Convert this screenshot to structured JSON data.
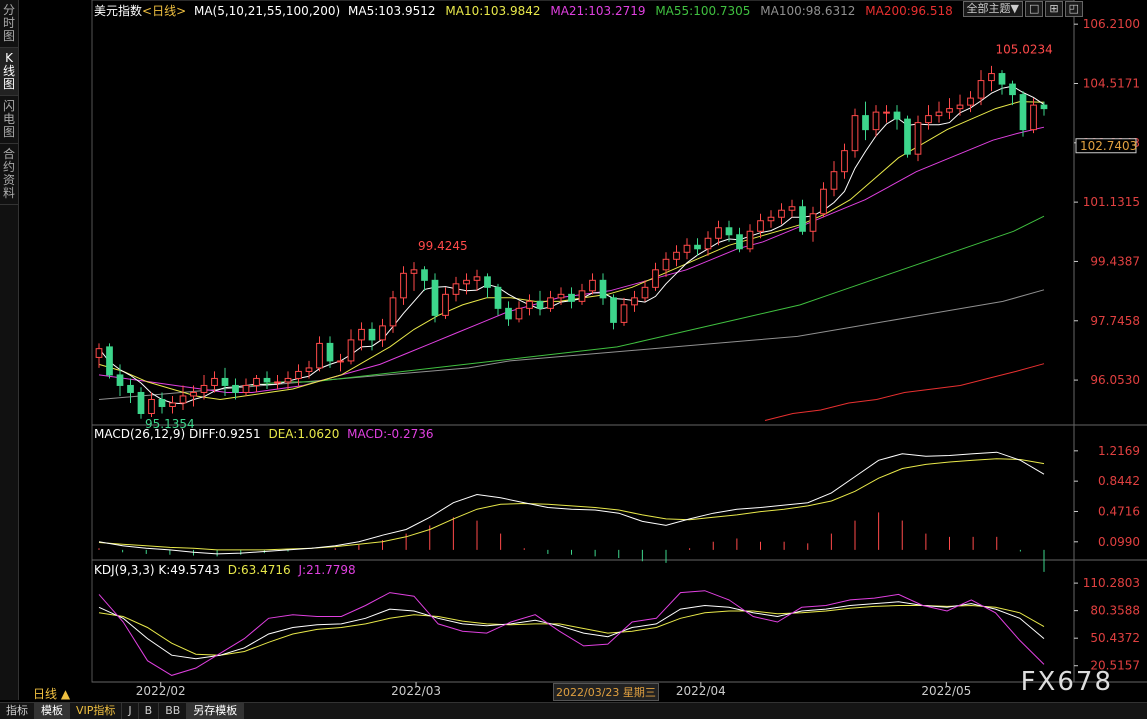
{
  "side_tabs": [
    {
      "label": "分时图"
    },
    {
      "label": "K线图"
    },
    {
      "label": "闪电图"
    },
    {
      "label": "合约资料"
    }
  ],
  "header": {
    "name": "美元指数",
    "period_tag": "<日线>",
    "ma_params": "MA(5,10,21,55,100,200)",
    "ma5": "MA5:103.9512",
    "ma10": "MA10:103.9842",
    "ma21": "MA21:103.2719",
    "ma55": "MA55:100.7305",
    "ma100": "MA100:98.6312",
    "ma200": "MA200:96.518",
    "theme_btn": "全部主题▼"
  },
  "macd_header": {
    "name": "MACD(26,12,9)",
    "diff": "DIFF:0.9251",
    "dea": "DEA:1.0620",
    "macd": "MACD:-0.2736"
  },
  "kdj_header": {
    "name": "KDJ(9,3,3)",
    "k": "K:49.5743",
    "d": "D:63.4716",
    "j": "J:21.7798"
  },
  "bottom_tabs": [
    {
      "label": "指标"
    },
    {
      "label": "模板"
    },
    {
      "label": "VIP指标"
    },
    {
      "label": "J"
    },
    {
      "label": "B"
    },
    {
      "label": "BB"
    },
    {
      "label": "另存模板"
    }
  ],
  "period_label": "日线 ▲",
  "cursor_date": "2022/03/23 星期三",
  "watermark": "FX678",
  "colors": {
    "up": "#ff4a4a",
    "down": "#3dd68c",
    "ma5": "#ffffff",
    "ma10": "#e8e84a",
    "ma21": "#e040e0",
    "ma55": "#40c040",
    "ma100": "#909090",
    "ma200": "#e83030",
    "diff": "#ffffff",
    "dea": "#e8e84a",
    "k": "#ffffff",
    "d": "#e8e84a",
    "j": "#e040e0"
  },
  "chart_data": [
    {
      "type": "candlestick",
      "title": "美元指数<日线>",
      "ylim": [
        94.8,
        106.5
      ],
      "yticks": [
        "106.2100",
        "104.5171",
        "102.8243",
        "101.1315",
        "99.4387",
        "97.7458",
        "96.0530"
      ],
      "current_price": "102.7403",
      "xticks": [
        "2022/02",
        "2022/03",
        "2022/04",
        "2022/05"
      ],
      "annotations": [
        {
          "text": "105.0234",
          "value": 105.0234
        },
        {
          "text": "99.4245",
          "value": 99.4245
        },
        {
          "text": "95.1354",
          "value": 95.1354
        }
      ],
      "candles": [
        [
          96.7,
          96.95,
          96.4,
          97.1
        ],
        [
          97.0,
          96.2,
          96.1,
          97.1
        ],
        [
          96.2,
          95.9,
          95.6,
          96.5
        ],
        [
          95.9,
          95.7,
          95.4,
          96.1
        ],
        [
          95.7,
          95.1,
          94.95,
          95.85
        ],
        [
          95.1,
          95.5,
          95.0,
          95.7
        ],
        [
          95.5,
          95.3,
          95.1,
          95.7
        ],
        [
          95.3,
          95.4,
          95.1,
          95.6
        ],
        [
          95.4,
          95.6,
          95.2,
          95.9
        ],
        [
          95.6,
          95.7,
          95.3,
          95.9
        ],
        [
          95.7,
          95.9,
          95.5,
          96.2
        ],
        [
          95.9,
          96.1,
          95.7,
          96.3
        ],
        [
          96.1,
          95.9,
          95.6,
          96.4
        ],
        [
          95.9,
          95.7,
          95.5,
          96.1
        ],
        [
          95.7,
          95.9,
          95.6,
          96.1
        ],
        [
          95.9,
          96.1,
          95.7,
          96.2
        ],
        [
          96.1,
          96.0,
          95.8,
          96.3
        ],
        [
          96.0,
          96.0,
          95.8,
          96.2
        ],
        [
          96.0,
          96.1,
          95.8,
          96.3
        ],
        [
          96.1,
          96.3,
          95.9,
          96.5
        ],
        [
          96.3,
          96.4,
          96.1,
          96.6
        ],
        [
          96.4,
          97.1,
          96.3,
          97.3
        ],
        [
          97.1,
          96.6,
          96.4,
          97.3
        ],
        [
          96.6,
          96.6,
          96.3,
          96.8
        ],
        [
          96.6,
          97.2,
          96.5,
          97.5
        ],
        [
          97.2,
          97.5,
          96.9,
          97.7
        ],
        [
          97.5,
          97.2,
          96.9,
          97.7
        ],
        [
          97.2,
          97.6,
          97.0,
          97.8
        ],
        [
          97.6,
          98.4,
          97.4,
          98.6
        ],
        [
          98.4,
          99.1,
          98.2,
          99.3
        ],
        [
          99.1,
          99.2,
          98.6,
          99.42
        ],
        [
          99.2,
          98.9,
          98.6,
          99.3
        ],
        [
          98.9,
          97.9,
          97.7,
          99.1
        ],
        [
          97.9,
          98.5,
          97.8,
          98.7
        ],
        [
          98.5,
          98.8,
          98.3,
          99.0
        ],
        [
          98.8,
          98.9,
          98.5,
          99.1
        ],
        [
          98.9,
          99.0,
          98.6,
          99.2
        ],
        [
          99.0,
          98.7,
          98.4,
          99.1
        ],
        [
          98.7,
          98.1,
          97.9,
          98.8
        ],
        [
          98.1,
          97.8,
          97.6,
          98.3
        ],
        [
          97.8,
          98.1,
          97.7,
          98.3
        ],
        [
          98.1,
          98.3,
          97.9,
          98.5
        ],
        [
          98.3,
          98.1,
          97.9,
          98.6
        ],
        [
          98.1,
          98.4,
          98.0,
          98.6
        ],
        [
          98.4,
          98.5,
          98.2,
          98.7
        ],
        [
          98.5,
          98.3,
          98.1,
          98.7
        ],
        [
          98.3,
          98.6,
          98.2,
          98.8
        ],
        [
          98.6,
          98.9,
          98.5,
          99.1
        ],
        [
          98.9,
          98.4,
          98.2,
          99.1
        ],
        [
          98.4,
          97.7,
          97.5,
          98.5
        ],
        [
          97.7,
          98.2,
          97.6,
          98.4
        ],
        [
          98.2,
          98.4,
          98.0,
          98.6
        ],
        [
          98.4,
          98.7,
          98.3,
          98.9
        ],
        [
          98.7,
          99.2,
          98.6,
          99.4
        ],
        [
          99.2,
          99.5,
          99.0,
          99.7
        ],
        [
          99.5,
          99.7,
          99.3,
          99.9
        ],
        [
          99.7,
          99.9,
          99.5,
          100.1
        ],
        [
          99.9,
          99.8,
          99.6,
          100.1
        ],
        [
          99.8,
          100.1,
          99.6,
          100.3
        ],
        [
          100.1,
          100.4,
          99.9,
          100.6
        ],
        [
          100.4,
          100.2,
          100.0,
          100.6
        ],
        [
          100.2,
          99.8,
          99.7,
          100.4
        ],
        [
          99.8,
          100.3,
          99.7,
          100.5
        ],
        [
          100.3,
          100.6,
          100.1,
          100.8
        ],
        [
          100.6,
          100.7,
          100.4,
          100.9
        ],
        [
          100.7,
          100.9,
          100.5,
          101.1
        ],
        [
          100.9,
          101.0,
          100.7,
          101.2
        ],
        [
          101.0,
          100.3,
          100.2,
          101.2
        ],
        [
          100.3,
          100.8,
          100.0,
          101.0
        ],
        [
          100.8,
          101.5,
          100.7,
          101.7
        ],
        [
          101.5,
          102.0,
          101.3,
          102.3
        ],
        [
          102.0,
          102.6,
          101.8,
          102.8
        ],
        [
          102.6,
          103.6,
          102.4,
          103.8
        ],
        [
          103.6,
          103.2,
          102.9,
          104.0
        ],
        [
          103.2,
          103.7,
          103.0,
          103.9
        ],
        [
          103.7,
          103.7,
          103.4,
          103.9
        ],
        [
          103.7,
          103.5,
          103.2,
          103.9
        ],
        [
          103.5,
          102.5,
          102.4,
          103.6
        ],
        [
          102.5,
          103.4,
          102.3,
          103.6
        ],
        [
          103.4,
          103.6,
          103.2,
          103.9
        ],
        [
          103.6,
          103.7,
          103.4,
          104.0
        ],
        [
          103.7,
          103.8,
          103.5,
          104.1
        ],
        [
          103.8,
          103.9,
          103.6,
          104.2
        ],
        [
          103.9,
          104.1,
          103.7,
          104.3
        ],
        [
          104.1,
          104.6,
          103.9,
          104.9
        ],
        [
          104.6,
          104.8,
          104.3,
          105.02
        ],
        [
          104.8,
          104.5,
          104.2,
          104.9
        ],
        [
          104.5,
          104.2,
          103.9,
          104.6
        ],
        [
          104.2,
          103.2,
          103.0,
          104.3
        ],
        [
          103.2,
          103.9,
          103.1,
          104.1
        ],
        [
          103.9,
          103.8,
          103.6,
          104.0
        ]
      ],
      "ma5": [
        [
          96.6,
          null
        ],
        [
          96.5,
          96.1
        ],
        [
          96.1,
          95.8
        ],
        [
          95.8,
          95.6
        ],
        [
          95.5,
          95.5
        ],
        [
          95.3,
          95.4
        ],
        [
          95.4,
          95.5
        ],
        [
          95.6,
          95.8
        ],
        [
          95.9,
          96.0
        ],
        [
          96.0,
          96.0
        ],
        [
          96.1,
          96.2
        ],
        [
          96.5,
          96.7
        ],
        [
          96.8,
          97.0
        ],
        [
          97.4,
          98.0
        ],
        [
          98.3,
          98.7
        ],
        [
          98.7,
          98.6
        ],
        [
          98.4,
          98.4
        ],
        [
          98.3,
          98.2
        ],
        [
          98.1,
          98.2
        ],
        [
          98.4,
          98.5
        ],
        [
          98.5,
          98.4
        ],
        [
          98.4,
          98.6
        ],
        [
          98.6,
          98.9
        ],
        [
          99.2,
          99.5
        ],
        [
          99.8,
          100.0
        ],
        [
          100.2,
          100.3
        ],
        [
          100.4,
          100.4
        ],
        [
          100.4,
          100.5
        ],
        [
          100.6,
          100.7
        ],
        [
          100.8,
          100.9
        ],
        [
          101.1,
          101.7
        ],
        [
          102.3,
          102.9
        ],
        [
          103.3,
          103.4
        ],
        [
          103.4,
          103.3
        ],
        [
          103.5,
          103.6
        ],
        [
          103.8,
          104.0
        ],
        [
          104.3,
          104.5
        ],
        [
          104.4,
          104.2
        ],
        [
          104.0,
          103.95
        ]
      ],
      "ma_lines": {
        "ma10": [
          96.5,
          96.3,
          96.0,
          95.8,
          95.6,
          95.5,
          95.6,
          95.7,
          95.8,
          96.0,
          96.2,
          96.6,
          97.0,
          97.5,
          97.9,
          98.2,
          98.4,
          98.4,
          98.3,
          98.3,
          98.4,
          98.5,
          98.7,
          99.0,
          99.3,
          99.6,
          99.9,
          100.1,
          100.3,
          100.5,
          100.8,
          101.2,
          101.8,
          102.4,
          102.8,
          103.2,
          103.5,
          103.8,
          104.0,
          103.98
        ],
        "ma21": [
          96.2,
          96.1,
          96.0,
          95.9,
          95.8,
          95.7,
          95.7,
          95.8,
          95.9,
          96.1,
          96.3,
          96.5,
          96.8,
          97.1,
          97.4,
          97.7,
          98.0,
          98.2,
          98.4,
          98.5,
          98.6,
          98.8,
          99.0,
          99.2,
          99.5,
          99.8,
          100.0,
          100.3,
          100.6,
          100.9,
          101.2,
          101.6,
          102.0,
          102.3,
          102.6,
          102.9,
          103.1,
          103.27
        ],
        "ma55": [
          null,
          null,
          null,
          null,
          null,
          95.9,
          96.0,
          96.0,
          96.1,
          96.2,
          96.3,
          96.4,
          96.5,
          96.6,
          96.7,
          96.8,
          96.9,
          97.0,
          97.2,
          97.4,
          97.6,
          97.8,
          98.0,
          98.2,
          98.5,
          98.8,
          99.1,
          99.4,
          99.7,
          100.0,
          100.3,
          100.73
        ],
        "ma100": [
          95.5,
          95.6,
          95.7,
          95.8,
          95.9,
          96.0,
          96.1,
          96.2,
          96.3,
          96.4,
          96.6,
          96.7,
          96.8,
          96.9,
          97.0,
          97.1,
          97.2,
          97.3,
          97.5,
          97.7,
          97.9,
          98.1,
          98.3,
          98.63
        ],
        "ma200": [
          null,
          null,
          null,
          null,
          null,
          null,
          null,
          null,
          null,
          null,
          null,
          94.9,
          95.1,
          95.2,
          95.4,
          95.5,
          95.7,
          95.8,
          95.9,
          96.1,
          96.3,
          96.52
        ]
      }
    },
    {
      "type": "line+bar",
      "title": "MACD(26,12,9)",
      "ylim": [
        -0.1,
        1.35
      ],
      "yticks": [
        "1.2169",
        "0.8442",
        "0.4716",
        "0.0990"
      ],
      "diff": [
        0.1,
        0.05,
        0.02,
        0.0,
        -0.03,
        -0.05,
        -0.04,
        -0.02,
        0.0,
        0.02,
        0.05,
        0.1,
        0.18,
        0.25,
        0.4,
        0.58,
        0.68,
        0.64,
        0.58,
        0.52,
        0.5,
        0.49,
        0.45,
        0.35,
        0.3,
        0.38,
        0.45,
        0.5,
        0.52,
        0.55,
        0.58,
        0.7,
        0.9,
        1.1,
        1.18,
        1.15,
        1.16,
        1.18,
        1.2,
        1.1,
        0.93
      ],
      "dea": [
        0.09,
        0.07,
        0.05,
        0.03,
        0.02,
        0.0,
        0.0,
        0.0,
        0.01,
        0.02,
        0.04,
        0.07,
        0.1,
        0.16,
        0.25,
        0.38,
        0.5,
        0.56,
        0.57,
        0.56,
        0.54,
        0.52,
        0.49,
        0.43,
        0.38,
        0.37,
        0.4,
        0.43,
        0.47,
        0.5,
        0.54,
        0.6,
        0.72,
        0.88,
        1.0,
        1.05,
        1.08,
        1.1,
        1.12,
        1.11,
        1.06
      ],
      "hist": [
        0.02,
        -0.03,
        -0.05,
        -0.06,
        -0.07,
        -0.08,
        -0.06,
        -0.04,
        -0.02,
        0.0,
        0.02,
        0.06,
        0.12,
        0.2,
        0.3,
        0.4,
        0.36,
        0.2,
        0.02,
        -0.05,
        -0.06,
        -0.08,
        -0.1,
        -0.14,
        -0.16,
        0.02,
        0.1,
        0.14,
        0.1,
        0.1,
        0.08,
        0.2,
        0.36,
        0.46,
        0.36,
        0.2,
        0.16,
        0.16,
        0.16,
        -0.02,
        -0.27
      ]
    },
    {
      "type": "line",
      "title": "KDJ(9,3,3)",
      "ylim": [
        5,
        118
      ],
      "yticks": [
        "110.2803",
        "80.3588",
        "50.4372",
        "20.5157"
      ],
      "k": [
        84,
        72,
        50,
        32,
        28,
        32,
        40,
        55,
        62,
        65,
        66,
        72,
        82,
        80,
        72,
        66,
        64,
        66,
        70,
        64,
        56,
        52,
        62,
        66,
        82,
        86,
        84,
        78,
        74,
        80,
        82,
        86,
        88,
        90,
        86,
        84,
        88,
        82,
        72,
        50
      ],
      "d": [
        78,
        74,
        62,
        45,
        33,
        32,
        36,
        46,
        55,
        60,
        62,
        66,
        72,
        76,
        74,
        69,
        66,
        65,
        66,
        66,
        61,
        56,
        58,
        62,
        72,
        78,
        80,
        80,
        77,
        78,
        80,
        83,
        85,
        86,
        86,
        85,
        86,
        84,
        78,
        63
      ],
      "j": [
        98,
        68,
        26,
        10,
        18,
        34,
        50,
        72,
        76,
        74,
        74,
        86,
        100,
        96,
        66,
        58,
        56,
        68,
        76,
        58,
        42,
        44,
        68,
        72,
        100,
        102,
        92,
        74,
        68,
        84,
        86,
        92,
        94,
        98,
        86,
        80,
        92,
        78,
        48,
        22
      ]
    }
  ]
}
